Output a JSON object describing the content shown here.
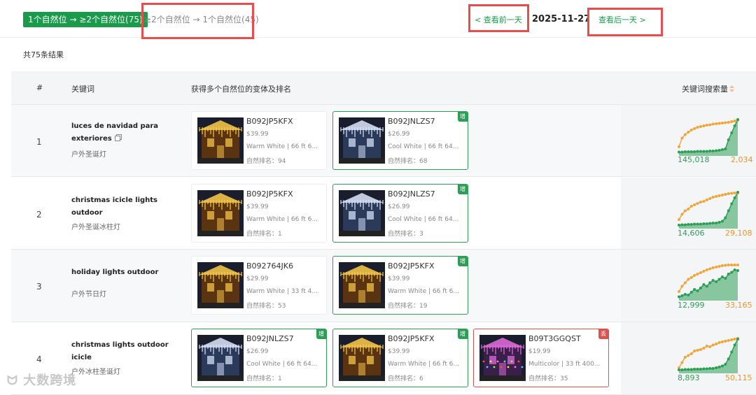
{
  "tabs": {
    "active": "1个自然位 → ≥2个自然位(75)",
    "inactive": "≥2个自然位 → 1个自然位(45)"
  },
  "nav": {
    "prev": "< 查看前一天",
    "date": "2025-11-27",
    "next": "查看后一天 >"
  },
  "result_count": "共75条结果",
  "table": {
    "headers": [
      "#",
      "关键词",
      "获得多个自然位的变体及排名",
      "关键词搜索量"
    ],
    "rows": [
      {
        "num": "1",
        "keyword": "luces de navidad para exteriores",
        "keyword_cn": "户外圣诞灯",
        "has_copy": true,
        "cards": [
          {
            "asin": "B092JP5KFX",
            "price": "$39.99",
            "variant": "Warm White | 66 ft 6...",
            "rank": "自然排名：94",
            "style": "plain",
            "badge": "",
            "thumb": "warm"
          },
          {
            "asin": "B092JNLZS7",
            "price": "$26.99",
            "variant": "Cool White | 66 ft 64...",
            "rank": "自然排名：68",
            "style": "green",
            "badge": "增",
            "thumb": "cool"
          }
        ],
        "vol_green": "145,018",
        "vol_orange": "2,034",
        "trend_orange": [
          0.2,
          0.45,
          0.55,
          0.62,
          0.68,
          0.72,
          0.76,
          0.78,
          0.8,
          0.82,
          0.83,
          0.85,
          0.86,
          0.87,
          0.88,
          0.89,
          0.9,
          0.92,
          0.94,
          0.96
        ],
        "trend_green": [
          0.05,
          0.05,
          0.06,
          0.06,
          0.06,
          0.06,
          0.07,
          0.07,
          0.07,
          0.07,
          0.08,
          0.08,
          0.09,
          0.1,
          0.12,
          0.14,
          0.4,
          0.6,
          0.8,
          0.98
        ]
      },
      {
        "num": "2",
        "keyword": "christmas icicle lights outdoor",
        "keyword_cn": "户外圣诞冰柱灯",
        "has_copy": false,
        "cards": [
          {
            "asin": "B092JP5KFX",
            "price": "$39.99",
            "variant": "Warm White | 66 ft 6...",
            "rank": "自然排名：1",
            "style": "plain",
            "badge": "",
            "thumb": "warm"
          },
          {
            "asin": "B092JNLZS7",
            "price": "$26.99",
            "variant": "Cool White | 66 ft 64...",
            "rank": "自然排名：3",
            "style": "green",
            "badge": "增",
            "thumb": "cool"
          }
        ],
        "vol_green": "14,606",
        "vol_orange": "29,108",
        "trend_orange": [
          0.2,
          0.35,
          0.45,
          0.5,
          0.58,
          0.62,
          0.66,
          0.7,
          0.72,
          0.76,
          0.8,
          0.84,
          0.86,
          0.88,
          0.9,
          0.92,
          0.94,
          0.95,
          0.96,
          0.96
        ],
        "trend_green": [
          0.04,
          0.05,
          0.05,
          0.06,
          0.06,
          0.07,
          0.07,
          0.07,
          0.08,
          0.08,
          0.09,
          0.1,
          0.1,
          0.12,
          0.15,
          0.25,
          0.45,
          0.65,
          0.82,
          0.98
        ]
      },
      {
        "num": "3",
        "keyword": "holiday lights outdoor",
        "keyword_cn": "户外节日灯",
        "has_copy": false,
        "cards": [
          {
            "asin": "B092764JK6",
            "price": "$29.99",
            "variant": "Warm White | 33 ft 4...",
            "rank": "自然排名：53",
            "style": "plain",
            "badge": "",
            "thumb": "warm"
          },
          {
            "asin": "B092JP5KFX",
            "price": "$39.99",
            "variant": "Warm White | 66 ft 6...",
            "rank": "自然排名：19",
            "style": "green",
            "badge": "增",
            "thumb": "warm"
          }
        ],
        "vol_green": "12,999",
        "vol_orange": "33,165",
        "trend_orange": [
          0.2,
          0.35,
          0.45,
          0.55,
          0.6,
          0.66,
          0.7,
          0.74,
          0.78,
          0.82,
          0.85,
          0.88,
          0.9,
          0.92,
          0.94,
          0.95,
          0.96,
          0.96,
          0.96,
          0.96
        ],
        "trend_green": [
          0.05,
          0.08,
          0.12,
          0.1,
          0.18,
          0.26,
          0.22,
          0.3,
          0.4,
          0.35,
          0.45,
          0.52,
          0.48,
          0.55,
          0.62,
          0.58,
          0.7,
          0.75,
          0.82,
          0.8
        ]
      },
      {
        "num": "4",
        "keyword": "christmas lights outdoor icicle",
        "keyword_cn": "户外冰柱圣诞灯",
        "has_copy": false,
        "cards": [
          {
            "asin": "B092JNLZS7",
            "price": "$26.99",
            "variant": "Cool White | 66 ft 64...",
            "rank": "自然排名：1",
            "style": "green",
            "badge": "增",
            "thumb": "cool"
          },
          {
            "asin": "B092JP5KFX",
            "price": "$39.99",
            "variant": "Warm White | 66 ft 6...",
            "rank": "自然排名：6",
            "style": "green",
            "badge": "增",
            "thumb": "warm"
          },
          {
            "asin": "B09T3GGQST",
            "price": "$19.99",
            "variant": "Multicolor | 33 ft 400...",
            "rank": "自然排名：35",
            "style": "red",
            "badge": "丢",
            "thumb": "multi"
          }
        ],
        "vol_green": "8,893",
        "vol_orange": "50,115",
        "trend_orange": [
          0.1,
          0.25,
          0.4,
          0.45,
          0.5,
          0.58,
          0.6,
          0.62,
          0.66,
          0.72,
          0.7,
          0.75,
          0.78,
          0.82,
          0.84,
          0.86,
          0.88,
          0.9,
          0.92,
          0.94
        ],
        "trend_green": [
          0.04,
          0.04,
          0.05,
          0.05,
          0.05,
          0.06,
          0.06,
          0.06,
          0.07,
          0.07,
          0.08,
          0.08,
          0.1,
          0.12,
          0.15,
          0.2,
          0.35,
          0.55,
          0.75,
          0.92
        ]
      }
    ]
  },
  "watermark": "大数跨境",
  "colors": {
    "brand_green": "#1a9b4b",
    "card_green": "#2e9e57",
    "card_red": "#d9534f",
    "trend_orange": "#f0a63a",
    "highlight_red": "#e64d4d"
  }
}
